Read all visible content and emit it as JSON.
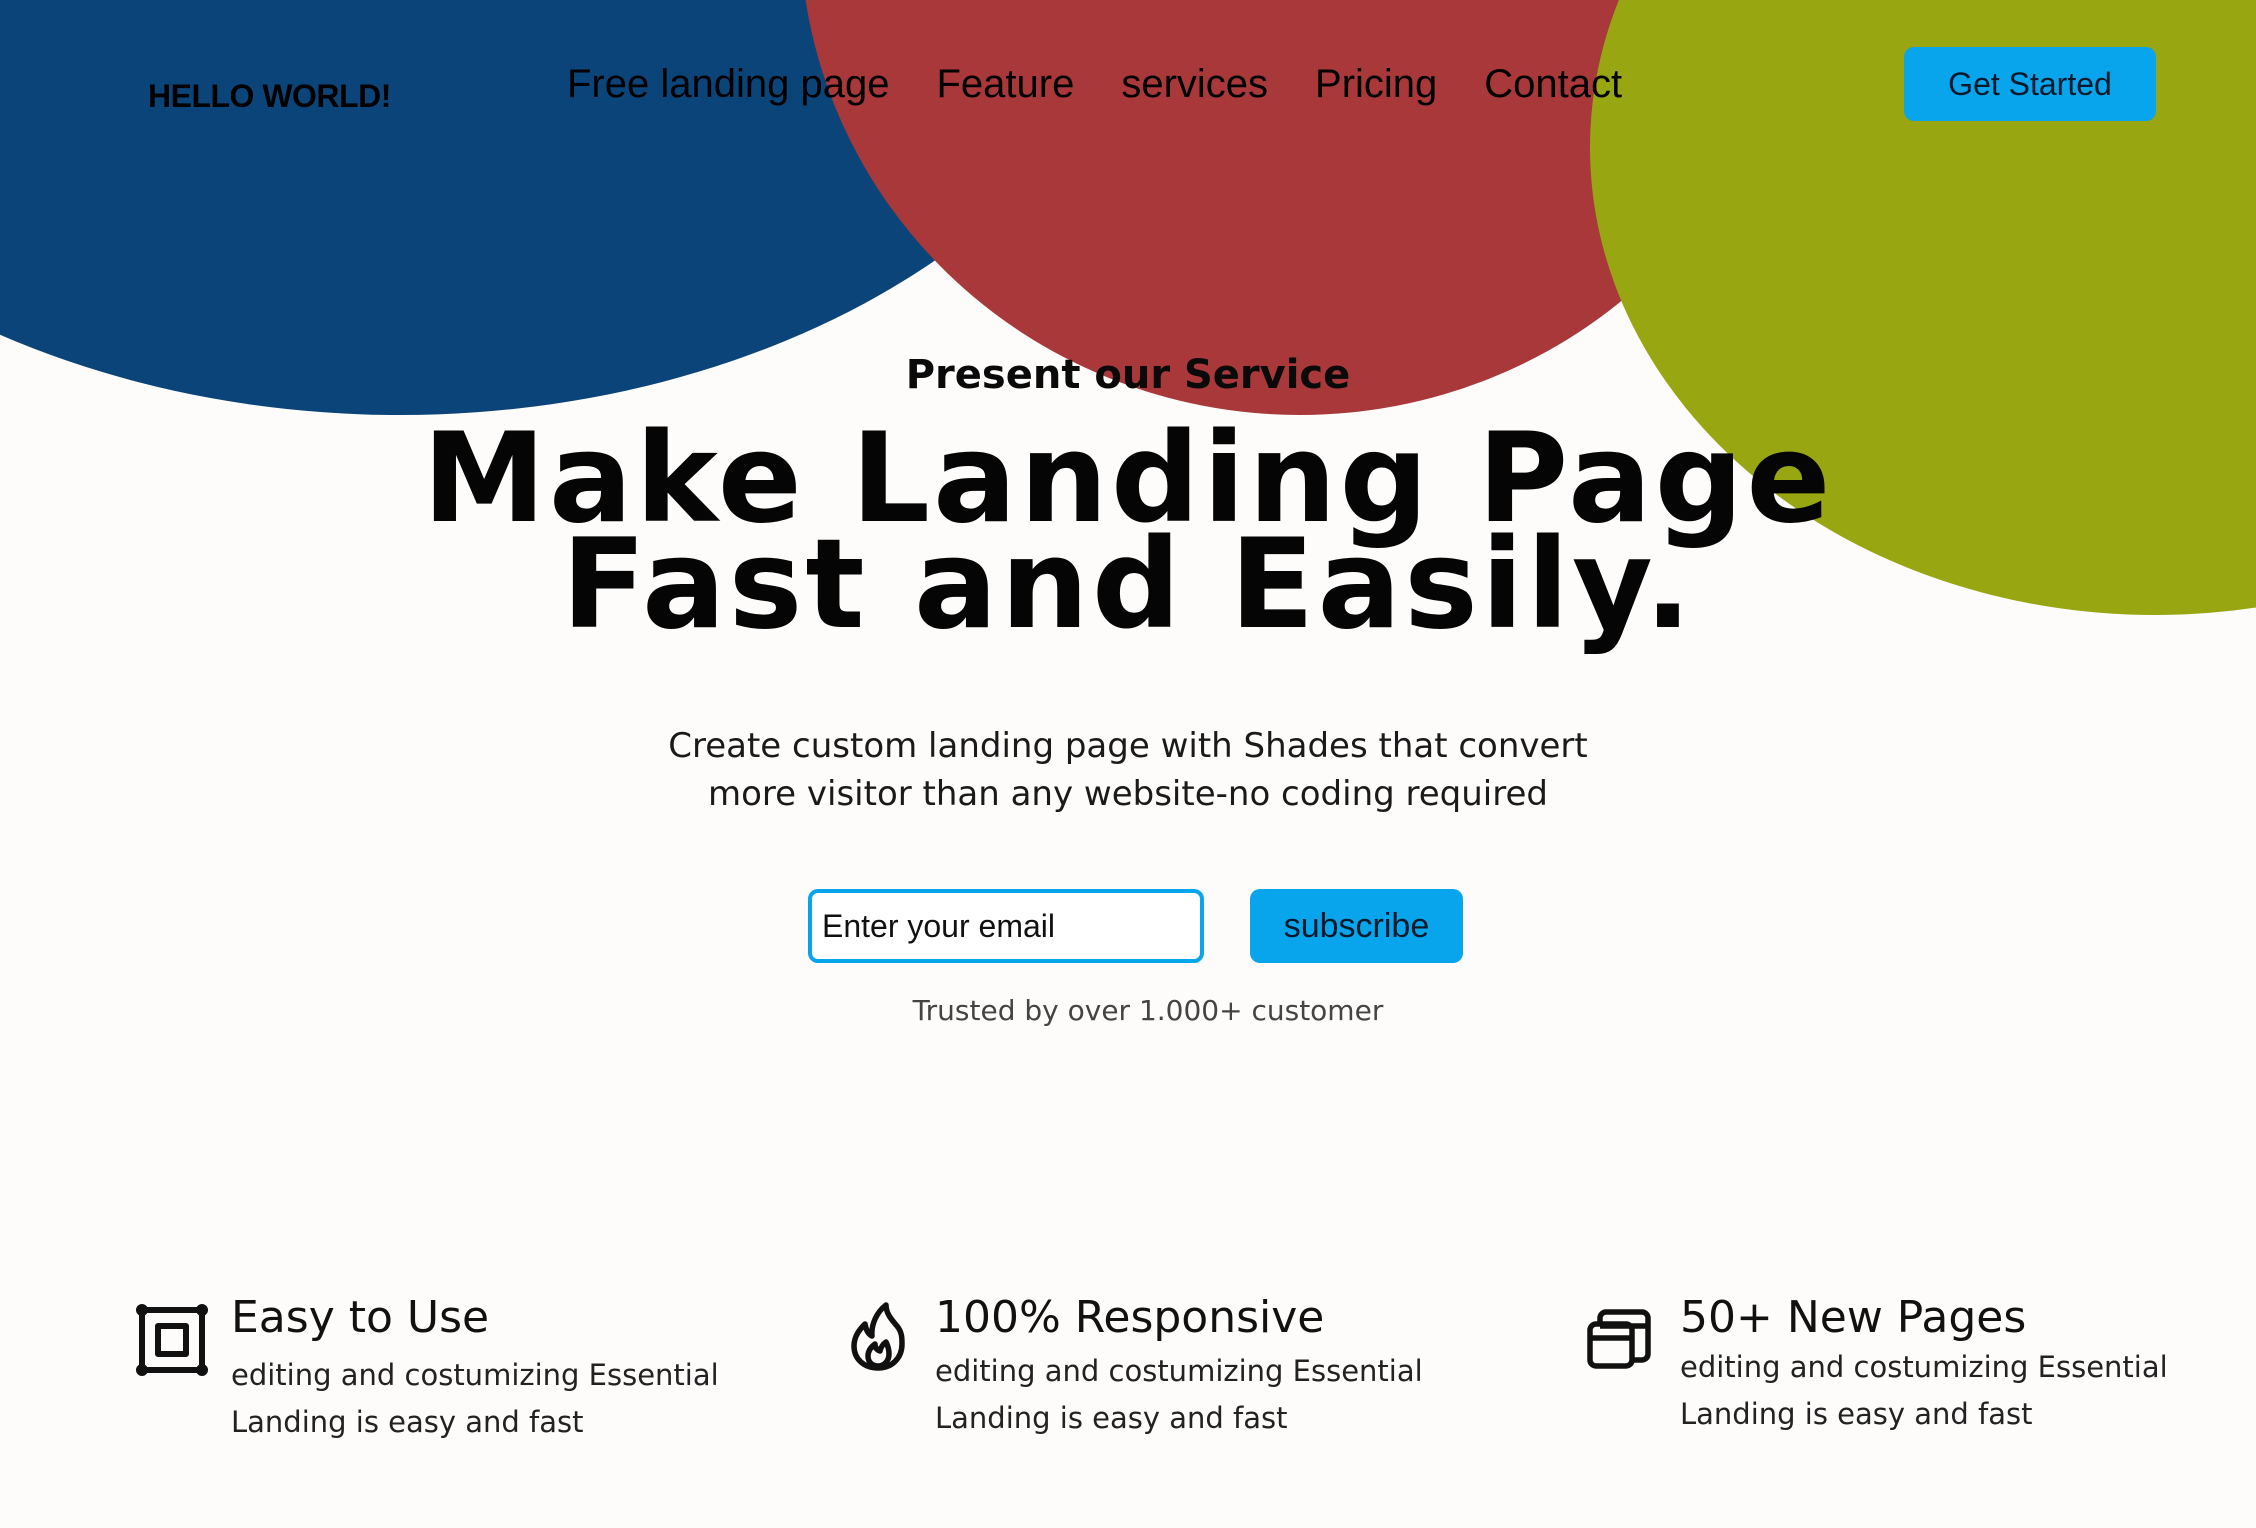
{
  "brand": {
    "logo_text": "HELLO WORLD!",
    "accent_color": "#08a4ec",
    "shape_colors": [
      "#0b4479",
      "#a8383a",
      "#98a612"
    ]
  },
  "nav": {
    "items": [
      {
        "label": "Free landing page"
      },
      {
        "label": "Feature"
      },
      {
        "label": "services"
      },
      {
        "label": "Pricing"
      },
      {
        "label": "Contact"
      }
    ],
    "cta_label": "Get Started"
  },
  "hero": {
    "eyebrow": "Present our Service",
    "headline_line1": "Make Landing Page",
    "headline_line2": "Fast and Easily.",
    "subtext_line1": "Create custom landing page with Shades that convert",
    "subtext_line2": "more visitor than any website-no coding required",
    "email_placeholder": "Enter your email",
    "subscribe_label": "subscribe",
    "trusted_text": "Trusted by over 1.000+ customer"
  },
  "features": [
    {
      "icon": "frame-icon",
      "title": "Easy to Use",
      "desc_line1": "editing and costumizing Essential",
      "desc_line2": "Landing is easy and fast"
    },
    {
      "icon": "flame-icon",
      "title": "100% Responsive",
      "desc_line1": "editing and costumizing Essential",
      "desc_line2": "Landing is easy and fast"
    },
    {
      "icon": "stacked-pages-icon",
      "title": "50+ New Pages",
      "desc_line1": "editing and costumizing Essential",
      "desc_line2": "Landing is easy and fast"
    }
  ]
}
